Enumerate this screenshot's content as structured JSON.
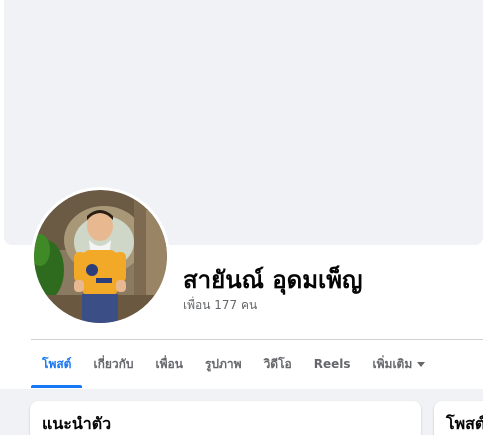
{
  "profile": {
    "name": "สายันณ์ อุดมเพ็ญ",
    "friends_prefix": "เพื่อน",
    "friends_count": "177",
    "friends_suffix": "คน"
  },
  "tabs": [
    {
      "label": "โพสต์",
      "active": true
    },
    {
      "label": "เกี่ยวกับ",
      "active": false
    },
    {
      "label": "เพื่อน",
      "active": false
    },
    {
      "label": "รูปภาพ",
      "active": false
    },
    {
      "label": "วิดีโอ",
      "active": false
    },
    {
      "label": "Reels",
      "active": false
    },
    {
      "label": "เพิ่มเติม",
      "active": false
    }
  ],
  "cards": {
    "intro_title": "แนะนำตัว",
    "posts_title": "โพสต์"
  },
  "colors": {
    "accent": "#1877f2",
    "cover": "#f0f2f5",
    "secondary_text": "#65676b"
  },
  "icons": {
    "more_tab": "caret-down-icon"
  }
}
